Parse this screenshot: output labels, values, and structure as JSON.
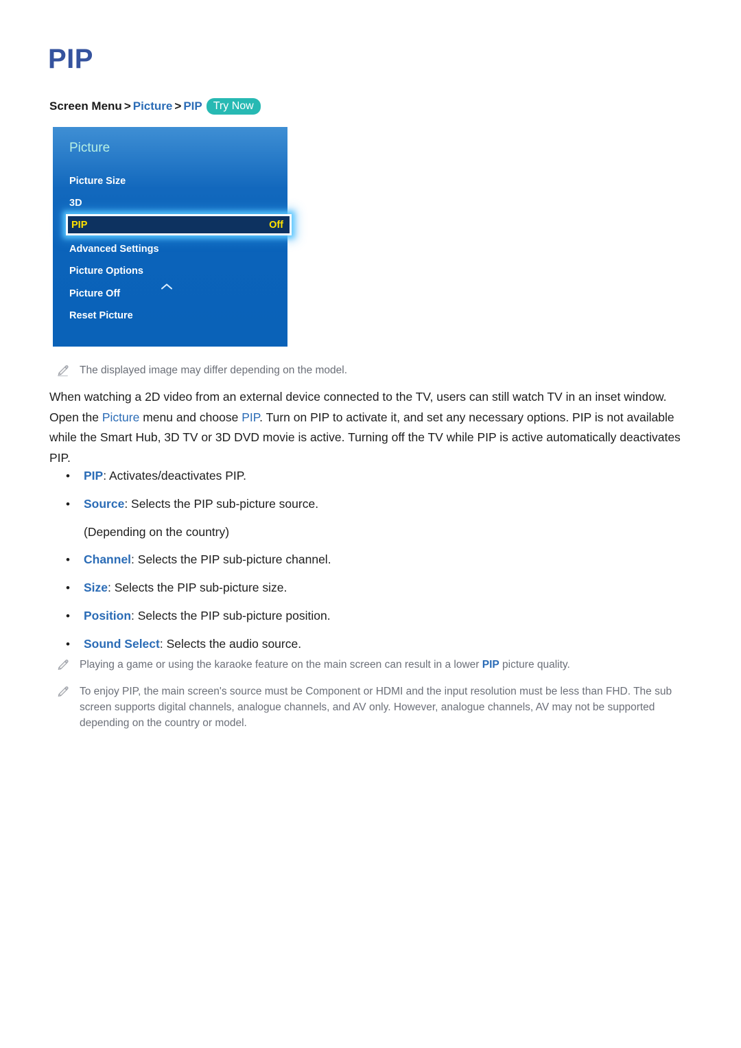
{
  "page": {
    "title": "PIP"
  },
  "breadcrumb": {
    "root": "Screen Menu",
    "sep1": ">",
    "level1": "Picture",
    "sep2": ">",
    "level2": "PIP",
    "badge": "Try Now"
  },
  "tv_menu": {
    "header": "Picture",
    "items": [
      {
        "label": "Picture Size",
        "value": ""
      },
      {
        "label": "3D",
        "value": ""
      },
      {
        "label": "PIP",
        "value": "Off",
        "selected": true
      },
      {
        "label": "Advanced Settings",
        "value": ""
      },
      {
        "label": "Picture Options",
        "value": ""
      },
      {
        "label": "Picture Off",
        "value": ""
      },
      {
        "label": "Reset Picture",
        "value": ""
      }
    ],
    "selected_label": "PIP",
    "selected_value": "Off",
    "colors": {
      "panel_top": "#3f8fd4",
      "panel_bottom": "#0a62b8",
      "header_text": "#b6f0e4",
      "selected_bg": "#0d3260",
      "selected_text": "#ffe100",
      "glow": "#5ac8ff"
    }
  },
  "notes": {
    "model": "The displayed image may differ depending on the model.",
    "game_prefix": "Playing a game or using the karaoke feature on the main screen can result in a lower ",
    "game_highlight": "PIP",
    "game_suffix": " picture quality.",
    "enjoy": "To enjoy PIP, the main screen's source must be Component or HDMI and the input resolution must be less than FHD. The sub screen supports digital channels, analogue channels, and AV only. However, analogue channels, AV may not be supported depending on the country or model."
  },
  "body": {
    "p1_part1": "When watching a 2D video from an external device connected to the TV, users can still watch TV in an inset window. Open the ",
    "p1_hl1": "Picture",
    "p1_part2": " menu and choose ",
    "p1_hl2": "PIP",
    "p1_part3": ". Turn on PIP to activate it, and set any necessary options. PIP is not available while the Smart Hub, 3D TV or 3D DVD movie is active. Turning off the TV while PIP is active automatically deactivates PIP."
  },
  "bullets": [
    {
      "bullet": "•",
      "term": "PIP",
      "desc": ": Activates/deactivates PIP.",
      "sub": ""
    },
    {
      "bullet": "•",
      "term": "Source",
      "desc": ": Selects the PIP sub-picture source.",
      "sub": "(Depending on the country)"
    },
    {
      "bullet": "•",
      "term": "Channel",
      "desc": ": Selects the PIP sub-picture channel.",
      "sub": ""
    },
    {
      "bullet": "•",
      "term": "Size",
      "desc": ": Selects the PIP sub-picture size.",
      "sub": ""
    },
    {
      "bullet": "•",
      "term": "Position",
      "desc": ": Selects the PIP sub-picture position.",
      "sub": ""
    },
    {
      "bullet": "•",
      "term": "Sound Select",
      "desc": ": Selects the audio source.",
      "sub": ""
    }
  ],
  "colors": {
    "heading": "#35539e",
    "link": "#2b6cb6",
    "body_text": "#1d1d1d",
    "note_text": "#6b6f78",
    "badge_bg": "#27b9b3"
  }
}
